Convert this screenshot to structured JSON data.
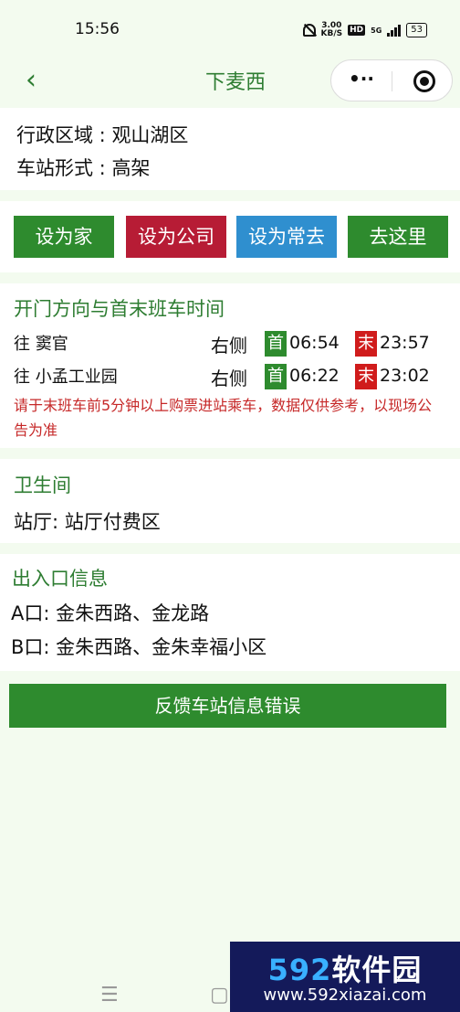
{
  "status_bar": {
    "time": "15:56",
    "speed_value": "3.00",
    "speed_unit": "KB/S",
    "hd": "HD",
    "network": "5G",
    "battery": "53"
  },
  "nav": {
    "back_icon": "chevron-left-icon",
    "title": "下麦西",
    "more_icon": "more-dots-icon",
    "more_glyph": "•··",
    "close_icon": "target-icon"
  },
  "station_info": {
    "district_label": "行政区域 : ",
    "district_value": "观山湖区",
    "form_label": "车站形式 : ",
    "form_value": "高架"
  },
  "actions": {
    "home": "设为家",
    "company": "设为公司",
    "frequent": "设为常去",
    "go_here": "去这里"
  },
  "directions": {
    "title": "开门方向与首末班车时间",
    "first_label": "首",
    "last_label": "末",
    "rows": [
      {
        "to": "往 窦官",
        "side": "右侧",
        "first": "06:54",
        "last": "23:57"
      },
      {
        "to": "往 小孟工业园",
        "side": "右侧",
        "first": "06:22",
        "last": "23:02"
      }
    ],
    "notice": "请于末班车前5分钟以上购票进站乘车，数据仅供参考，以现场公告为准"
  },
  "toilet": {
    "title": "卫生间",
    "label": "站厅: ",
    "value": "站厅付费区"
  },
  "exits": {
    "title": "出入口信息",
    "items": [
      {
        "name": "A口: ",
        "roads": "金朱西路、金龙路"
      },
      {
        "name": "B口: ",
        "roads": "金朱西路、金朱幸福小区"
      }
    ]
  },
  "feedback_button": "反馈车站信息错误",
  "system_nav": {
    "menu_glyph": "☰",
    "home_glyph": "▢"
  },
  "watermark": {
    "logo_num": "592",
    "logo_text": "软件园",
    "url": "www.592xiazai.com"
  },
  "colors": {
    "brand_green": "#2e8b2e",
    "title_green": "#2e7d32",
    "red": "#b71c35",
    "blue": "#2f8fcf",
    "notice_red": "#c62828",
    "background": "#f3fbef"
  }
}
